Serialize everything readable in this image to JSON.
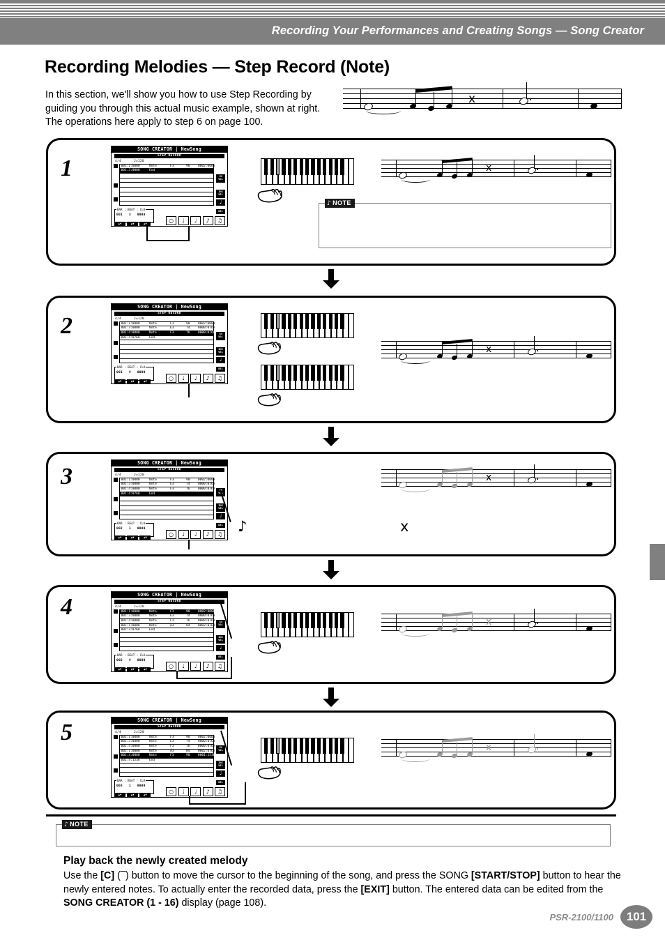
{
  "header": {
    "title": "Recording Your Performances and Creating Songs — Song Creator"
  },
  "page_title": "Recording Melodies — Step Record (Note)",
  "intro": "In this section, we'll show you how to use Step Recording by guiding you through this actual music example, shown at right. The operations here apply to step 6 on page 100.",
  "lcd_common": {
    "title": "SONG CREATOR | NewSong",
    "subtitle": "STEP RECORD",
    "time_signature": "4/4",
    "tempo": "J=120",
    "bbc_header": "BAR  :  BEAT  :  CLK",
    "side_buttons": [
      "CH\nVOL",
      "INS\nVEL",
      "NOTE",
      "DEL"
    ],
    "arrow_labels": [
      "▲▼",
      "▲▼",
      "▲▼"
    ],
    "note_buttons": [
      "♬",
      "♩",
      "♩",
      "♪",
      "♫"
    ]
  },
  "steps": [
    {
      "number": "1",
      "lcd": {
        "rows": [
          {
            "addr": "001:1:0000",
            "event": "Note",
            "note": "F3",
            "vel": "90",
            "gate": "0002:0000",
            "selected": false
          },
          {
            "addr": "001:3:0000",
            "event": "End",
            "note": "",
            "vel": "",
            "gate": "",
            "selected": true
          }
        ],
        "bar": "001",
        "beat": "3",
        "clk": "0000",
        "highlighted_note_button": 1
      },
      "keyboards": 1
    },
    {
      "number": "2",
      "lcd": {
        "rows": [
          {
            "addr": "001:1:0000",
            "event": "Note",
            "note": "F3",
            "vel": "90",
            "gate": "0002:0000",
            "selected": false
          },
          {
            "addr": "001:3:0000",
            "event": "Note",
            "note": "E3",
            "vel": "74",
            "gate": "0000:0768",
            "selected": false
          },
          {
            "addr": "001:4:0000",
            "event": "Note",
            "note": "F3",
            "vel": "76",
            "gate": "0000:0768",
            "selected": true
          },
          {
            "addr": "001:4:0768",
            "event": "End",
            "note": "",
            "vel": "",
            "gate": "",
            "selected": false
          }
        ],
        "bar": "001",
        "beat": "4",
        "clk": "0000",
        "highlighted_note_button": 3
      },
      "keyboards": 2
    },
    {
      "number": "3",
      "lcd": {
        "rows": [
          {
            "addr": "001:1:0000",
            "event": "Note",
            "note": "F3",
            "vel": "90",
            "gate": "0002:0000",
            "selected": false
          },
          {
            "addr": "001:3:0000",
            "event": "Note",
            "note": "E3",
            "vel": "74",
            "gate": "0000:0768",
            "selected": false
          },
          {
            "addr": "001:4:0000",
            "event": "Note",
            "note": "F3",
            "vel": "76",
            "gate": "0000:0768",
            "selected": false
          },
          {
            "addr": "001:4:0768",
            "event": "End",
            "note": "",
            "vel": "",
            "gate": "",
            "selected": true
          }
        ],
        "bar": "002",
        "beat": "1",
        "clk": "0000",
        "highlighted_note_button": 3
      },
      "keyboards": 0,
      "symbols": {
        "eighth": "♪",
        "rest": "⸟"
      }
    },
    {
      "number": "4",
      "lcd": {
        "rows": [
          {
            "addr": "001:1:0000",
            "event": "Note",
            "note": "F3",
            "vel": "90",
            "gate": "0002:0000",
            "selected": true
          },
          {
            "addr": "001:3:0000",
            "event": "Note",
            "note": "E3",
            "vel": "74",
            "gate": "0000:0768",
            "selected": false
          },
          {
            "addr": "001:4:0000",
            "event": "Note",
            "note": "F3",
            "vel": "76",
            "gate": "0000:0768",
            "selected": false
          },
          {
            "addr": "002:1:0000",
            "event": "Note",
            "note": "A3",
            "vel": "84",
            "gate": "0002:0768",
            "selected": false
          },
          {
            "addr": "002:3:0768",
            "event": "End",
            "note": "",
            "vel": "",
            "gate": "",
            "selected": false
          }
        ],
        "bar": "002",
        "beat": "4",
        "clk": "0000",
        "highlighted_note_button": 1
      },
      "keyboards": 1
    },
    {
      "number": "5",
      "lcd": {
        "rows": [
          {
            "addr": "001:1:0000",
            "event": "Note",
            "note": "F3",
            "vel": "90",
            "gate": "0002:0000",
            "selected": false
          },
          {
            "addr": "001:3:0000",
            "event": "Note",
            "note": "E3",
            "vel": "74",
            "gate": "0000:0768",
            "selected": false
          },
          {
            "addr": "001:4:0000",
            "event": "Note",
            "note": "F3",
            "vel": "76",
            "gate": "0000:0768",
            "selected": false
          },
          {
            "addr": "002:1:0000",
            "event": "Note",
            "note": "A3",
            "vel": "84",
            "gate": "0002:0768",
            "selected": false
          },
          {
            "addr": "002:4:0000",
            "event": "Note",
            "note": "F3",
            "vel": "90",
            "gate": "0001:1536",
            "selected": true
          },
          {
            "addr": "002:4:1536",
            "event": "End",
            "note": "",
            "vel": "",
            "gate": "",
            "selected": false
          }
        ],
        "bar": "003",
        "beat": "1",
        "clk": "0000",
        "highlighted_note_button": 2
      },
      "keyboards": 1
    }
  ],
  "note_callouts": [
    {
      "label": "NOTE",
      "text": ""
    },
    {
      "label": "NOTE",
      "text": ""
    }
  ],
  "playback": {
    "heading": "Play back the newly created melody",
    "line1_a": "Use the ",
    "line1_b": "[C]",
    "line1_c": " (",
    "line1_d": ") button to move the cursor to the beginning of the song, and press the SONG ",
    "line1_e": "[START/STOP]",
    "line1_f": " button to hear the newly entered notes. To actually enter the recorded data, press the ",
    "line1_g": "[EXIT]",
    "line1_h": " button. The entered data can be edited from the ",
    "line1_i": "SONG CREATOR (1 - 16)",
    "line1_j": " display (page 108)."
  },
  "footer": {
    "model": "PSR-2100/1100",
    "page_number": "101"
  },
  "colors": {
    "header_gray": "#808080",
    "page_badge": "#7d7d7d",
    "ghost_note": "#9a9a9a",
    "ink": "#000000"
  }
}
